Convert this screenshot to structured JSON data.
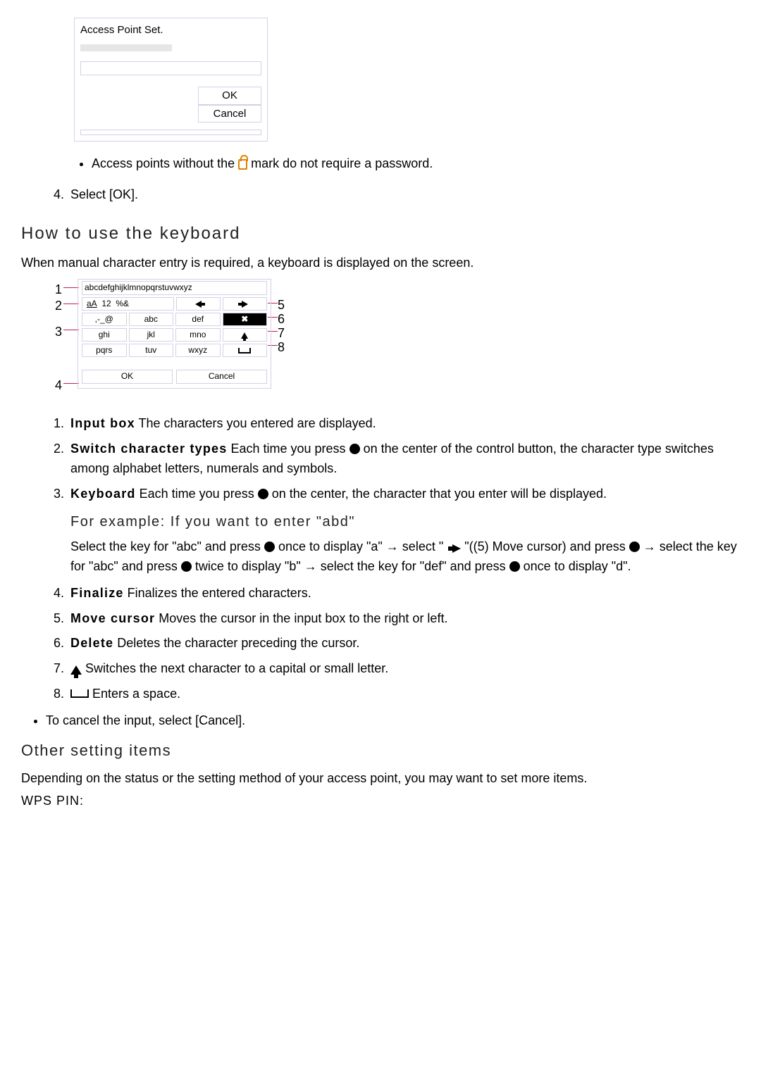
{
  "ap_dialog": {
    "title": "Access Point Set.",
    "ok": "OK",
    "cancel": "Cancel"
  },
  "note_access_no_lock_a": "Access points without the ",
  "note_access_no_lock_b": " mark do not require a password.",
  "step4": "Select [OK].",
  "kb_heading": "How to use the keyboard",
  "kb_intro": "When manual character entry is required, a keyboard is displayed on the screen.",
  "kb_diagram": {
    "n1": "1",
    "n2": "2",
    "n3": "3",
    "n4": "4",
    "n5": "5",
    "n6": "6",
    "n7": "7",
    "n8": "8",
    "input": "abcdefghijklmnopqrstuvwxyz",
    "switch": "aA  12  %&",
    "row2": {
      "a": ",-_@",
      "b": "abc",
      "c": "def"
    },
    "row3": {
      "a": "ghi",
      "b": "jkl",
      "c": "mno"
    },
    "row4": {
      "a": "pqrs",
      "b": "tuv",
      "c": "wxyz"
    },
    "ok": "OK",
    "cancel": "Cancel",
    "del": "✖"
  },
  "kb": {
    "i1_term": "Input box",
    "i1_text": " The characters you entered are displayed.",
    "i2_term": "Switch character types",
    "i2_a": " Each time you press ",
    "i2_b": " on the center of the control button, the character type switches among alphabet letters, numerals and symbols.",
    "i3_term": "Keyboard",
    "i3_a": " Each time you press ",
    "i3_b": " on the center, the character that you enter will be displayed.",
    "ex_head": "For example: If you want to enter \"abd\"",
    "ex_a": "Select the key for \"abc\" and press ",
    "ex_b": " once to display \"a\" → select \" ",
    "ex_c": " \"((5) Move cursor) and press ",
    "ex_d": " → select the key for \"abc\" and press ",
    "ex_e": " twice to display \"b\" → select the key for \"def\" and press ",
    "ex_f": " once to display \"d\".",
    "i4_term": "Finalize",
    "i4_text": " Finalizes the entered characters.",
    "i5_term": "Move cursor",
    "i5_text": " Moves the cursor in the input box to the right or left.",
    "i6_term": "Delete",
    "i6_text": " Deletes the character preceding the cursor.",
    "i7_text": " Switches the next character to a capital or small letter.",
    "i8_text": " Enters a space."
  },
  "cancel_note": "To cancel the input, select [Cancel].",
  "other_heading": "Other setting items",
  "other_text": "Depending on the status or the setting method of your access point, you may want to set more items.",
  "wps": "WPS PIN:"
}
